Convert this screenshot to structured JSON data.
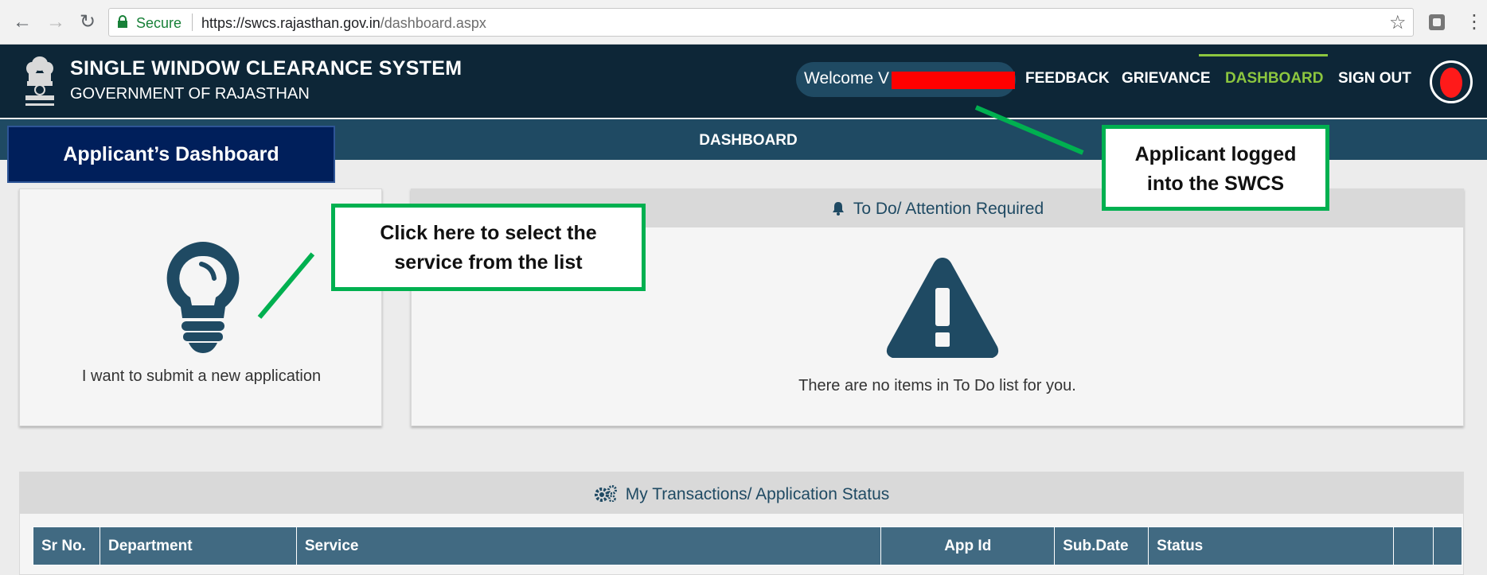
{
  "browser": {
    "secure_label": "Secure",
    "url_host": "https://swcs.rajasthan.gov.in",
    "url_path": "/dashboard.aspx",
    "icons": [
      "back-icon",
      "forward-icon",
      "reload-icon",
      "lock-icon",
      "star-icon",
      "extension-icon",
      "menu-icon"
    ]
  },
  "header": {
    "title": "SINGLE WINDOW CLEARANCE SYSTEM",
    "subtitle": "GOVERNMENT OF RAJASTHAN",
    "welcome": "Welcome V",
    "nav": {
      "feedback": "FEEDBACK",
      "grievance": "GRIEVANCE",
      "dashboard": "DASHBOARD",
      "sign_out": "SIGN OUT"
    },
    "colors": {
      "background": "#0d2637",
      "active": "#8cc63f"
    }
  },
  "page_bar": {
    "title": "DASHBOARD"
  },
  "new_application": {
    "label": "I want to submit a new application"
  },
  "todo": {
    "title": "To Do/ Attention Required",
    "empty_message": "There are no items in To Do list for you."
  },
  "transactions": {
    "title": "My Transactions/ Application Status",
    "columns": [
      "Sr No.",
      "Department",
      "Service",
      "App Id",
      "Sub.Date",
      "Status",
      "",
      ""
    ]
  },
  "annotations": {
    "dashboard_label": "Applicant’s Dashboard",
    "select_service": [
      "Click here to select the",
      "service from the list"
    ],
    "logged_in": [
      "Applicant logged",
      "into the SWCS"
    ],
    "color": "#00b050"
  }
}
